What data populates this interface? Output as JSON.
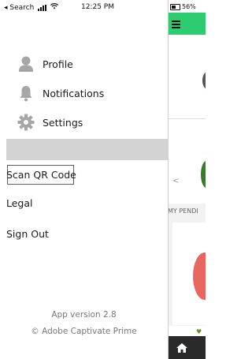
{
  "status_bar": {
    "back_label": "◂ Search",
    "time": "12:25 PM",
    "battery": "56%"
  },
  "drawer": {
    "menu": [
      {
        "label": "Profile",
        "icon": "user-icon"
      },
      {
        "label": "Notifications",
        "icon": "bell-icon"
      },
      {
        "label": "Settings",
        "icon": "gear-icon"
      }
    ],
    "links": [
      {
        "label": "Scan QR Code"
      },
      {
        "label": "Legal"
      },
      {
        "label": "Sign Out"
      }
    ],
    "footer": {
      "version": "App version 2.8",
      "copyright": "© Adobe Captivate Prime"
    }
  },
  "background_app": {
    "header_color": "#2ecc71",
    "section_label": "MY PENDI",
    "chevron": "<"
  },
  "colors": {
    "highlight_border": "#e0262e",
    "band": "#d3d3d3"
  }
}
